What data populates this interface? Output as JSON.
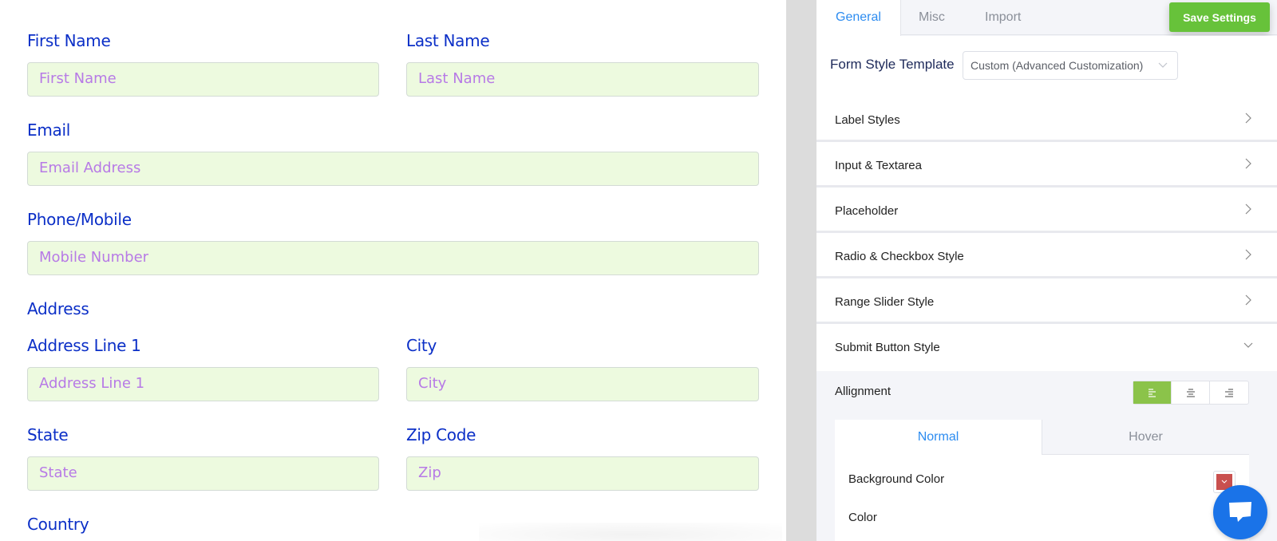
{
  "form": {
    "first_name": {
      "label": "First Name",
      "placeholder": "First Name"
    },
    "last_name": {
      "label": "Last Name",
      "placeholder": "Last Name"
    },
    "email": {
      "label": "Email",
      "placeholder": "Email Address"
    },
    "phone": {
      "label": "Phone/Mobile",
      "placeholder": "Mobile Number"
    },
    "address_heading": "Address",
    "address_line1": {
      "label": "Address Line 1",
      "placeholder": "Address Line 1"
    },
    "city": {
      "label": "City",
      "placeholder": "City"
    },
    "state": {
      "label": "State",
      "placeholder": "State"
    },
    "zip": {
      "label": "Zip Code",
      "placeholder": "Zip"
    },
    "country": {
      "label": "Country"
    }
  },
  "settings": {
    "tabs": [
      {
        "label": "General",
        "active": true
      },
      {
        "label": "Misc",
        "active": false
      },
      {
        "label": "Import",
        "active": false
      }
    ],
    "save_label": "Save Settings",
    "form_style_template": {
      "label": "Form Style Template",
      "selected": "Custom (Advanced Customization)"
    },
    "sections": [
      {
        "title": "Label Styles",
        "expanded": false
      },
      {
        "title": "Input & Textarea",
        "expanded": false
      },
      {
        "title": "Placeholder",
        "expanded": false
      },
      {
        "title": "Radio & Checkbox Style",
        "expanded": false
      },
      {
        "title": "Range Slider Style",
        "expanded": false
      },
      {
        "title": "Submit Button Style",
        "expanded": true
      }
    ],
    "submit_button": {
      "alignment_label": "Allignment",
      "alignment_selected": "left",
      "state_tabs": [
        {
          "label": "Normal",
          "active": true
        },
        {
          "label": "Hover",
          "active": false
        }
      ],
      "background_color_label": "Background Color",
      "background_color": "#c9504f",
      "color_label": "Color"
    }
  },
  "colors": {
    "label": "#0b2fc7",
    "input_bg": "#edfadf",
    "placeholder": "#b77ae6",
    "accent": "#2d8cf0",
    "save": "#67c23a",
    "chat": "#1a73e8"
  }
}
